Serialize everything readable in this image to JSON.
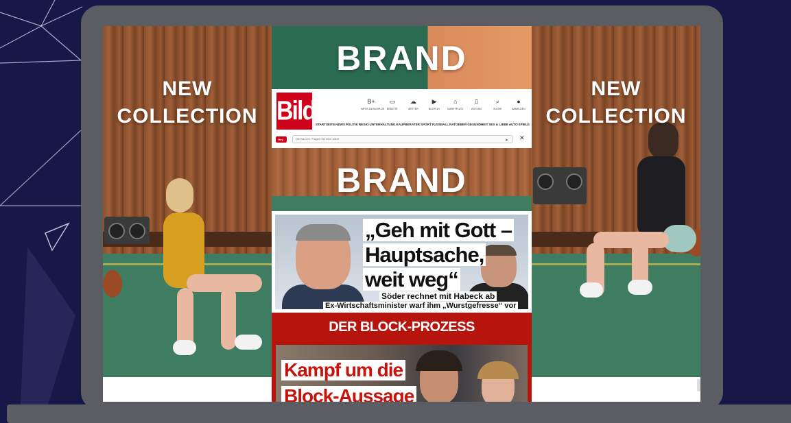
{
  "side_ads": {
    "left_title_line1": "NEW",
    "left_title_line2": "COLLECTION",
    "right_title_line1": "NEW",
    "right_title_line2": "COLLECTION"
  },
  "brand_banners": {
    "top_text": "BRAND",
    "mid_text": "BRAND"
  },
  "bild": {
    "logo": "Bild",
    "top_icons": [
      {
        "icon": "bildplus-icon",
        "glyph": "B+",
        "label": "INFOS ZU BILDPLUS"
      },
      {
        "icon": "chat-icon",
        "glyph": "▭",
        "label": "DEBATTE"
      },
      {
        "icon": "weather-icon",
        "glyph": "☁",
        "label": "WETTER"
      },
      {
        "icon": "bildplay-icon",
        "glyph": "▶",
        "label": "BILDPLAY"
      },
      {
        "icon": "bag-icon",
        "glyph": "⌂",
        "label": "MARKTPLATZ"
      },
      {
        "icon": "newspaper-icon",
        "glyph": "▯",
        "label": "ZEITUNG"
      },
      {
        "icon": "search-icon",
        "glyph": "⌕",
        "label": "SUCHE"
      },
      {
        "icon": "user-icon",
        "glyph": "●",
        "label": "ANMELDEN"
      }
    ],
    "nav": [
      "STARTSEITE",
      "NEWS",
      "POLITIK",
      "REGIO",
      "UNTERHALTUNG",
      "KAUFBERATER",
      "SPORT",
      "FUSSBALL",
      "RATGEBER",
      "GESUNDHEIT",
      "SEX & LIEBE",
      "AUTO",
      "SPIELE"
    ],
    "ai_bar": {
      "badge": "Hey_",
      "placeholder": "Die BILD-KI. Fragen Sie mich alles!",
      "close": "✕"
    }
  },
  "teaser": {
    "headline_line1": "„Geh mit Gott –",
    "headline_line2": "Hauptsache,",
    "headline_line3": "weit weg“",
    "kicker": "Söder rechnet mit Habeck ab",
    "subline": "Ex-Wirtschaftsminister warf ihm „Wurstgefresse“ vor"
  },
  "block_section": {
    "title": "DER BLOCK-PROZESS",
    "headline_line1": "Kampf um die",
    "headline_line2": "Block-Aussage"
  },
  "colors": {
    "background": "#181848",
    "device": "#5b5d63",
    "bild_red": "#d0021b",
    "block_red": "#b8140e"
  }
}
